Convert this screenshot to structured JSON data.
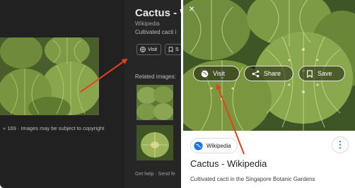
{
  "left_panel": {
    "title": "Cactus - W",
    "source": "Wikipedia",
    "description": "Cultivated cacti i",
    "visit_label": "Visit",
    "save_label": "S",
    "copyright": "« 169 · Images may be subject to copyright",
    "related_heading": "Related images:",
    "footer": "Get help · Send fe"
  },
  "right_panel": {
    "close_glyph": "×",
    "visit_label": "Visit",
    "share_label": "Share",
    "save_label": "Save",
    "source_chip": "Wikipedia",
    "menu_glyph": "⋮",
    "title": "Cactus - Wikipedia",
    "description": "Cultivated cacti in the Singapore Botanic Gardens"
  },
  "colors": {
    "arrow": "#e8401c",
    "panel_dark": "#212121",
    "accent": "#1a73e8"
  }
}
